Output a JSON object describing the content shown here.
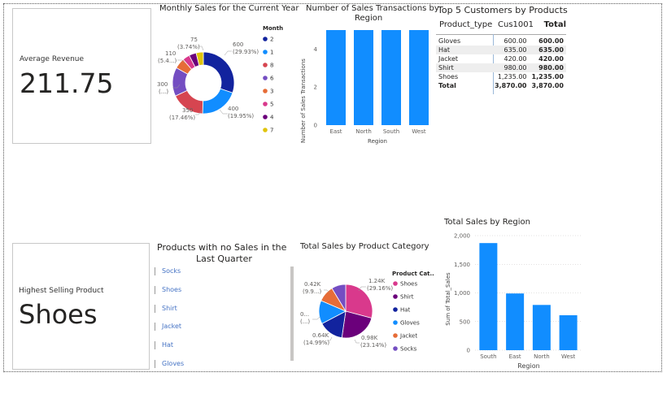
{
  "kpi_revenue": {
    "label": "Average Revenue",
    "value": "211.75"
  },
  "kpi_product": {
    "label": "Highest Selling Product",
    "value": "Shoes"
  },
  "monthly_sales": {
    "title": "Monthly Sales for the Current Year",
    "legend_title": "Month",
    "legend": [
      "2",
      "1",
      "8",
      "6",
      "3",
      "5",
      "4",
      "7"
    ],
    "labels": [
      {
        "l1": "600",
        "l2": "(29.93%)"
      },
      {
        "l1": "400",
        "l2": "(19.95%)"
      },
      {
        "l1": "350",
        "l2": "(17.46%)"
      },
      {
        "l1": "300",
        "l2": "(...)"
      },
      {
        "l1": "110",
        "l2": "(5.4...)"
      },
      {
        "l1": "75",
        "l2": "(3.74%)"
      }
    ]
  },
  "transactions": {
    "title_line1": "Number of Sales Transactions by",
    "title_line2": "Region",
    "ylabel": "Number of Sales Transactions",
    "xlabel": "Region"
  },
  "top_customers": {
    "title": "Top 5 Customers by Products",
    "headers": [
      "Product_type",
      "Cus1001",
      "Total"
    ],
    "rows": [
      [
        "Gloves",
        "600.00",
        "600.00"
      ],
      [
        "Hat",
        "635.00",
        "635.00"
      ],
      [
        "Jacket",
        "420.00",
        "420.00"
      ],
      [
        "Shirt",
        "980.00",
        "980.00"
      ],
      [
        "Shoes",
        "1,235.00",
        "1,235.00"
      ],
      [
        "Total",
        "3,870.00",
        "3,870.00"
      ]
    ]
  },
  "no_sales": {
    "title_line1": "Products with no Sales in the",
    "title_line2": "Last Quarter",
    "items": [
      "Socks",
      "Shoes",
      "Shirt",
      "Jacket",
      "Hat",
      "Gloves"
    ]
  },
  "category_sales": {
    "title": "Total Sales by Product Category",
    "legend_title": "Product Cat...",
    "legend": [
      "Shoes",
      "Shirt",
      "Hat",
      "Gloves",
      "Jacket",
      "Socks"
    ],
    "labels": [
      {
        "l1": "1.24K",
        "l2": "(29.16%)"
      },
      {
        "l1": "0.98K",
        "l2": "(23.14%)"
      },
      {
        "l1": "0.64K",
        "l2": "(14.99%)"
      },
      {
        "l1": "0...",
        "l2": "(...)"
      },
      {
        "l1": "0.42K",
        "l2": "(9.9...)"
      }
    ]
  },
  "region_sales": {
    "title": "Total Sales by Region",
    "ylabel": "Sum of Total_Sales",
    "xlabel": "Region"
  },
  "colors": {
    "bar": "#118dff",
    "series": [
      "#12239e",
      "#118dff",
      "#d64550",
      "#744ec2",
      "#e66c37",
      "#d9398c",
      "#6b007b",
      "#e0c40d"
    ]
  },
  "chart_data": [
    {
      "type": "pie",
      "title": "Monthly Sales for the Current Year",
      "categories": [
        "2",
        "1",
        "8",
        "6",
        "3",
        "5",
        "4",
        "7"
      ],
      "values": [
        600,
        400,
        350,
        300,
        110,
        75,
        75,
        75
      ]
    },
    {
      "type": "bar",
      "title": "Number of Sales Transactions by Region",
      "categories": [
        "East",
        "North",
        "South",
        "West"
      ],
      "values": [
        5,
        5,
        5,
        5
      ],
      "ylim": [
        0,
        5
      ],
      "yticks": [
        "0",
        "2",
        "4"
      ],
      "xlabel": "Region",
      "ylabel": "Number of Sales Transactions"
    },
    {
      "type": "pie",
      "title": "Total Sales by Product Category",
      "categories": [
        "Shoes",
        "Shirt",
        "Hat",
        "Gloves",
        "Jacket",
        "Socks"
      ],
      "values": [
        1235,
        980,
        635,
        600,
        420,
        365
      ]
    },
    {
      "type": "bar",
      "title": "Total Sales by Region",
      "categories": [
        "South",
        "East",
        "North",
        "West"
      ],
      "values": [
        1870,
        990,
        790,
        610
      ],
      "ylim": [
        0,
        2000
      ],
      "yticks": [
        "0",
        "500",
        "1,000",
        "1,500",
        "2,000"
      ],
      "xlabel": "Region",
      "ylabel": "Sum of Total_Sales"
    }
  ]
}
